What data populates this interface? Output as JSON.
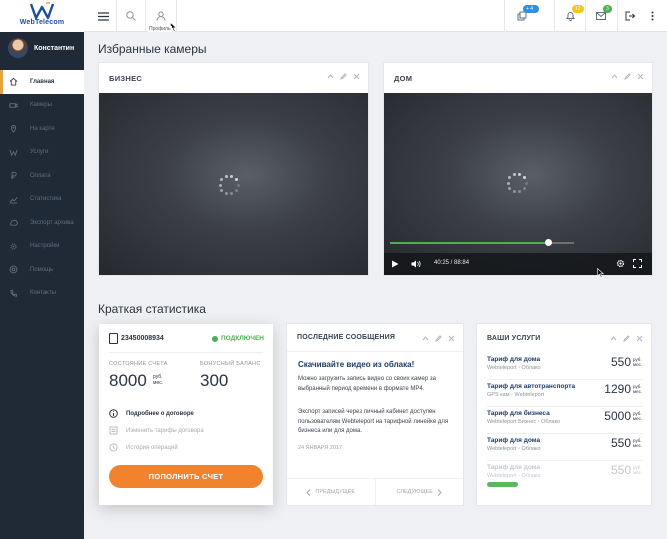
{
  "brand": {
    "logo_text": "WebTelecom"
  },
  "user": {
    "name": "Константин"
  },
  "sidebar": {
    "items": [
      {
        "label": "Главная",
        "icon": "home-icon",
        "active": true
      },
      {
        "label": "Камеры",
        "icon": "camera-icon",
        "active": false
      },
      {
        "label": "На карте",
        "icon": "map-pin-icon",
        "active": false
      },
      {
        "label": "Услуги",
        "icon": "services-icon",
        "active": false
      },
      {
        "label": "Оплата",
        "icon": "ruble-icon",
        "active": false
      },
      {
        "label": "Статистика",
        "icon": "chart-icon",
        "active": false
      },
      {
        "label": "Экспорт архива",
        "icon": "export-icon",
        "active": false
      },
      {
        "label": "Настройки",
        "icon": "gear-icon",
        "active": false
      },
      {
        "label": "Помощь",
        "icon": "help-icon",
        "active": false
      },
      {
        "label": "Контакты",
        "icon": "phone-icon",
        "active": false
      }
    ]
  },
  "topbar": {
    "tooltip": "Профиль",
    "badges": {
      "cameras": "+ 4 365 ₽",
      "notifications": "12",
      "mail": "3"
    },
    "colors": {
      "cameras_badge": "#2f8fe0",
      "notifications_badge": "#f0c419",
      "mail_badge": "#4caf50"
    }
  },
  "favorites": {
    "title": "Избранные камеры",
    "cameras": [
      {
        "name": "БИЗНЕС"
      },
      {
        "name": "ДОМ",
        "time": "40:25 / 88:84",
        "progress": 0.86
      }
    ]
  },
  "stats": {
    "title": "Краткая статистика",
    "account": {
      "number": "23450008934",
      "status": "ПОДКЛЮЧЕН",
      "balance_label": "СОСТОЯНИЕ СЧЕТА",
      "balance": "8000",
      "balance_currency": "руб.\nмес.",
      "bonus_label": "БОНУСНЫЙ БАЛАНС",
      "bonus": "300",
      "links": [
        "Подробнее о договоре",
        "Изменить тарифы договора",
        "История операций"
      ],
      "pay_button": "ПОПОЛНИТЬ СЧЕТ"
    },
    "messages": {
      "title": "ПОСЛЕДНИЕ СООБЩЕНИЯ",
      "headline": "Скачивайте видео из облака!",
      "p1": "Можно загрузить запись видео со своих камер за выбранный период времени в формате MP4.",
      "p2": "Экспорт записей через личный кабинет доступен пользователям Webteleport на тарифной линейке для бизнеса или для дома.",
      "date": "24 ЯНВАРЯ 2017",
      "prev": "ПРЕДЫДУЩЕЕ",
      "next": "СЛЕДУЮЩЕЕ"
    },
    "services": {
      "title": "ВАШИ УСЛУГИ",
      "currency": "руб.\nмес.",
      "items": [
        {
          "name": "Тариф для дома",
          "sub": "Webteleport ◦ Облако",
          "price": "550",
          "dim": false
        },
        {
          "name": "Тариф для автотранспорта",
          "sub": "GPS кам ◦ Webteleport",
          "price": "1290",
          "dim": false
        },
        {
          "name": "Тариф для бизнеса",
          "sub": "Webteleport Бизнес ◦ Облако",
          "price": "5000",
          "dim": false
        },
        {
          "name": "Тариф для дома",
          "sub": "Webteleport ◦ Облако",
          "price": "550",
          "dim": false
        },
        {
          "name": "Тариф для дома",
          "sub": "Webteleport ◦ Облако",
          "price": "550",
          "dim": true
        }
      ]
    }
  }
}
